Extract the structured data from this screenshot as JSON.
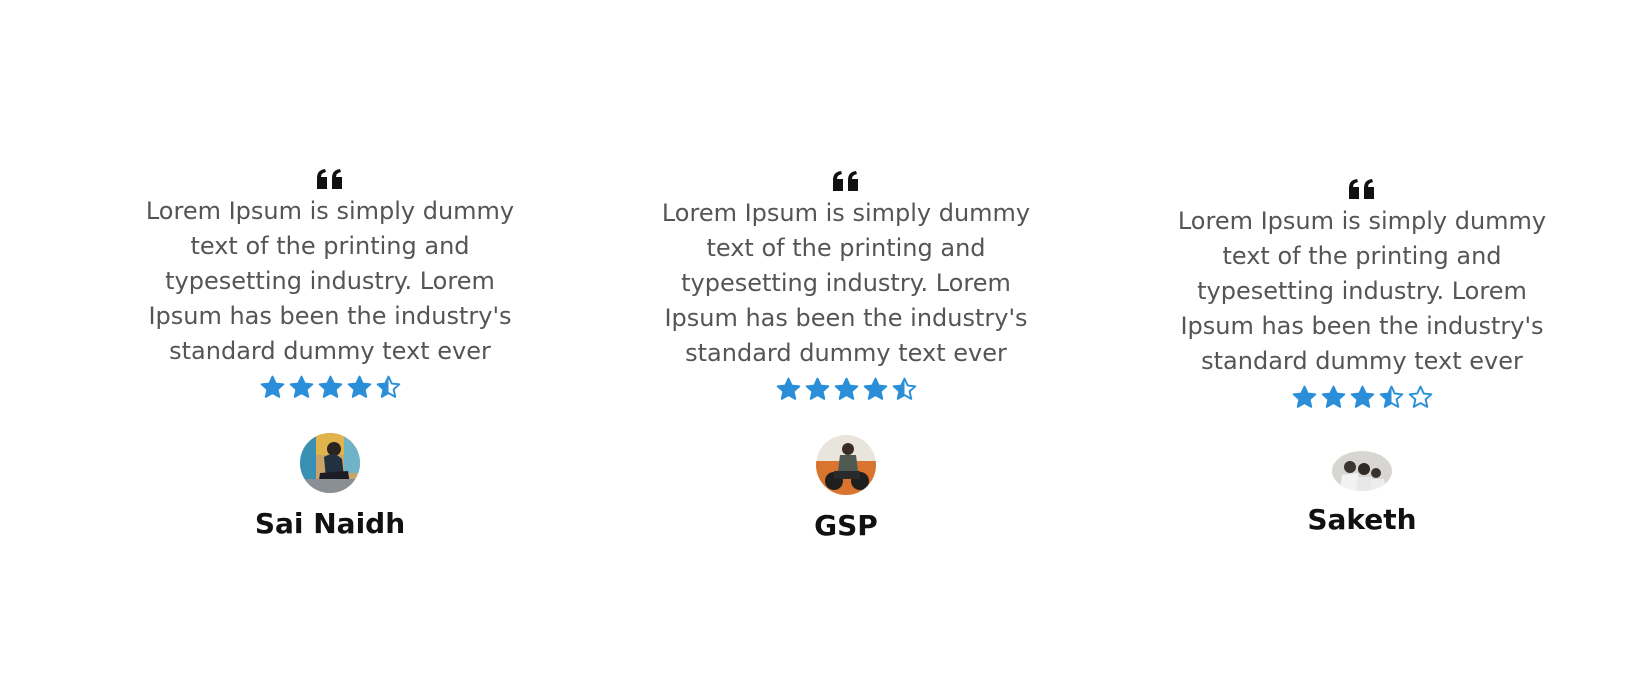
{
  "colors": {
    "star": "#2a8fd8",
    "text": "#555555",
    "name": "#111111",
    "quote_icon": "#111111"
  },
  "testimonials": [
    {
      "quote_icon": "quote-icon",
      "text": "Lorem Ipsum is simply dummy text of the printing and typesetting industry. Lorem Ipsum has been the industry's standard dummy text ever",
      "rating": 4.5,
      "rating_max": 5,
      "avatar": "avatar-photo-man-sitting",
      "name": "Sai Naidh"
    },
    {
      "quote_icon": "quote-icon",
      "text": "Lorem Ipsum is simply dummy text of the printing and typesetting industry. Lorem Ipsum has been the industry's standard dummy text ever",
      "rating": 4.5,
      "rating_max": 5,
      "avatar": "avatar-photo-man-motorcycle",
      "name": "GSP"
    },
    {
      "quote_icon": "quote-icon",
      "text": "Lorem Ipsum is simply dummy text of the printing and typesetting industry. Lorem Ipsum has been the industry's standard dummy text ever",
      "rating": 3.5,
      "rating_max": 5,
      "avatar": "avatar-photo-group",
      "name": "Saketh"
    }
  ]
}
